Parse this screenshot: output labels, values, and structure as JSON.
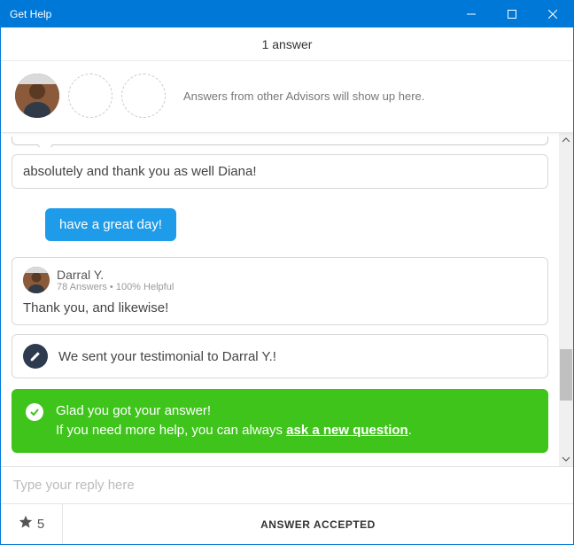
{
  "window": {
    "title": "Get Help"
  },
  "subheader": {
    "text": "1 answer"
  },
  "advisor_row": {
    "hint": "Answers from other Advisors will show up here."
  },
  "chat": {
    "msg1": "absolutely and thank you as well Diana!",
    "msg_blue": "have a great day!",
    "advisor": {
      "name": "Darral Y.",
      "sub": "78 Answers • 100% Helpful",
      "body": "Thank you, and likewise!"
    },
    "testimonial": "We sent your testimonial to Darral Y.!",
    "green": {
      "line1": "Glad you got your answer!",
      "line2_prefix": "If you need more help, you can always ",
      "line2_link": "ask a new question",
      "line2_suffix": "."
    }
  },
  "reply": {
    "placeholder": "Type your reply here"
  },
  "footer": {
    "rating": "5",
    "status": "ANSWER ACCEPTED"
  }
}
